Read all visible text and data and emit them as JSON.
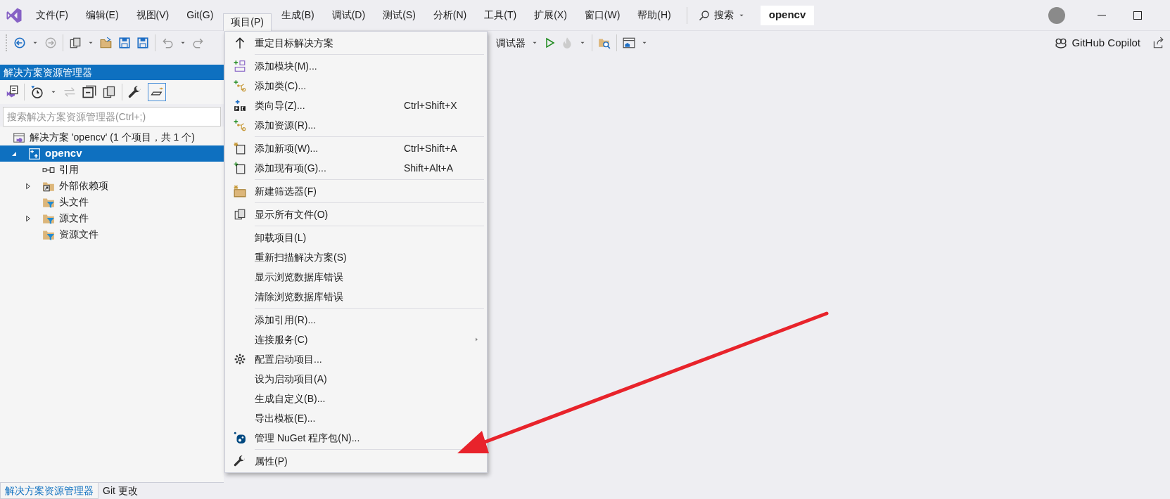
{
  "menu_bar": {
    "items": [
      {
        "label": "文件(F)",
        "selected": false
      },
      {
        "label": "编辑(E)",
        "selected": false
      },
      {
        "label": "视图(V)",
        "selected": false
      },
      {
        "label": "Git(G)",
        "selected": false
      },
      {
        "label": "项目(P)",
        "selected": true
      },
      {
        "label": "生成(B)",
        "selected": false
      },
      {
        "label": "调试(D)",
        "selected": false
      },
      {
        "label": "测试(S)",
        "selected": false
      },
      {
        "label": "分析(N)",
        "selected": false
      },
      {
        "label": "工具(T)",
        "selected": false
      },
      {
        "label": "扩展(X)",
        "selected": false
      },
      {
        "label": "窗口(W)",
        "selected": false
      },
      {
        "label": "帮助(H)",
        "selected": false
      }
    ],
    "search": "搜索",
    "solution_name": "opencv"
  },
  "toolbar": {
    "debugger_label": "调试器",
    "copilot": "GitHub Copilot"
  },
  "solution_explorer": {
    "title": "解决方案资源管理器",
    "search": {
      "placeholder": "搜索解决方案资源管理器(Ctrl+;)"
    },
    "solution": "解决方案 'opencv' (1 个项目，共 1 个)",
    "project": {
      "label": "opencv",
      "expanded": true,
      "selected": true,
      "children": [
        {
          "label": "引用",
          "kind": "reference",
          "expandable": false
        },
        {
          "label": "外部依赖项",
          "kind": "dependencies",
          "expandable": true
        },
        {
          "label": "头文件",
          "kind": "filter",
          "expandable": false
        },
        {
          "label": "源文件",
          "kind": "filter",
          "expandable": true
        },
        {
          "label": "资源文件",
          "kind": "filter",
          "expandable": false
        }
      ]
    }
  },
  "bottom_tabs": [
    {
      "label": "解决方案资源管理器",
      "selected": true
    },
    {
      "label": "Git 更改",
      "selected": false
    }
  ],
  "project_menu": {
    "groups": [
      [
        {
          "label": "重定目标解决方案",
          "kind": "up"
        }
      ],
      [
        {
          "label": "添加模块(M)...",
          "kind": "module"
        },
        {
          "label": "添加类(C)...",
          "kind": "class"
        },
        {
          "label": "类向导(Z)...",
          "kind": "wizard",
          "shortcut": "Ctrl+Shift+X"
        },
        {
          "label": "添加资源(R)...",
          "kind": "class"
        }
      ],
      [
        {
          "label": "添加新项(W)...",
          "kind": "new-item",
          "shortcut": "Ctrl+Shift+A"
        },
        {
          "label": "添加现有项(G)...",
          "kind": "existing-item",
          "shortcut": "Shift+Alt+A"
        }
      ],
      [
        {
          "label": "新建筛选器(F)",
          "kind": "folder"
        }
      ],
      [
        {
          "label": "显示所有文件(O)",
          "kind": "files"
        }
      ],
      [
        {
          "label": "卸载项目(L)",
          "kind": "plain"
        },
        {
          "label": "重新扫描解决方案(S)",
          "kind": "plain"
        },
        {
          "label": "显示浏览数据库错误",
          "kind": "plain"
        },
        {
          "label": "清除浏览数据库错误",
          "kind": "plain"
        }
      ],
      [
        {
          "label": "添加引用(R)...",
          "kind": "plain",
          "submenu": false
        },
        {
          "label": "连接服务(C)",
          "kind": "plain",
          "submenu": true
        },
        {
          "label": "配置启动项目...",
          "kind": "gear"
        },
        {
          "label": "设为启动项目(A)",
          "kind": "plain"
        },
        {
          "label": "生成自定义(B)...",
          "kind": "plain"
        },
        {
          "label": "导出模板(E)...",
          "kind": "plain"
        },
        {
          "label": "管理 NuGet 程序包(N)...",
          "kind": "nuget"
        }
      ],
      [
        {
          "label": "属性(P)",
          "kind": "wrench"
        }
      ]
    ]
  }
}
